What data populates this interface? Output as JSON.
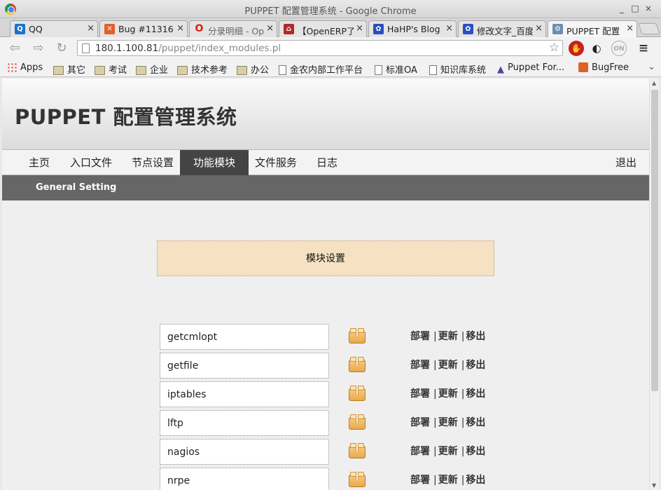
{
  "window": {
    "title": "PUPPET 配置管理系统 - Google Chrome",
    "controls": [
      "_",
      "□",
      "×"
    ]
  },
  "tabs": [
    {
      "label": "QQ",
      "icon": "qq-icon",
      "color": "#1a73c8",
      "glyph": "Q"
    },
    {
      "label": "Bug #11316",
      "icon": "bugfree-icon",
      "color": "#e0602a",
      "glyph": "✕"
    },
    {
      "label": "分录明细 - Op",
      "icon": "opera-icon",
      "color": "#ffffff",
      "glyph": "O"
    },
    {
      "label": "【OpenERP了",
      "icon": "openerp-icon",
      "color": "#b02a2a",
      "glyph": "⌂"
    },
    {
      "label": "HaHP's Blog",
      "icon": "paw-icon",
      "color": "#2a4fbf",
      "glyph": "✿"
    },
    {
      "label": "修改文字_百度",
      "icon": "baidu-icon",
      "color": "#2a4fbf",
      "glyph": "✿"
    },
    {
      "label": "PUPPET 配置",
      "icon": "puppet-icon",
      "color": "#6b8fb0",
      "glyph": "⚙"
    }
  ],
  "toolbar": {
    "url_host": "180.1.100.81",
    "url_path": "/puppet/index_modules.pl"
  },
  "bookmarks": [
    {
      "label": "Apps",
      "kind": "apps"
    },
    {
      "label": "其它",
      "kind": "folder"
    },
    {
      "label": "考试",
      "kind": "folder"
    },
    {
      "label": "企业",
      "kind": "folder"
    },
    {
      "label": "技术参考",
      "kind": "folder"
    },
    {
      "label": "办公",
      "kind": "folder"
    },
    {
      "label": "金农内部工作平台",
      "kind": "doc"
    },
    {
      "label": "标准OA",
      "kind": "doc"
    },
    {
      "label": "知识库系统",
      "kind": "doc"
    },
    {
      "label": "Puppet For...",
      "kind": "puppet"
    },
    {
      "label": "BugFree",
      "kind": "bugfree"
    }
  ],
  "site": {
    "title": "PUPPET 配置管理系统",
    "nav": [
      "主页",
      "入口文件",
      "节点设置",
      "功能模块",
      "文件服务",
      "日志"
    ],
    "active_nav": "功能模块",
    "logout": "退出",
    "subnav": "General Setting"
  },
  "banner": "模块设置",
  "actions": {
    "deploy": "部署",
    "update": "更新",
    "remove": "移出",
    "separator": "|"
  },
  "modules": [
    "getcmlopt",
    "getfile",
    "iptables",
    "lftp",
    "nagios",
    "nrpe"
  ]
}
